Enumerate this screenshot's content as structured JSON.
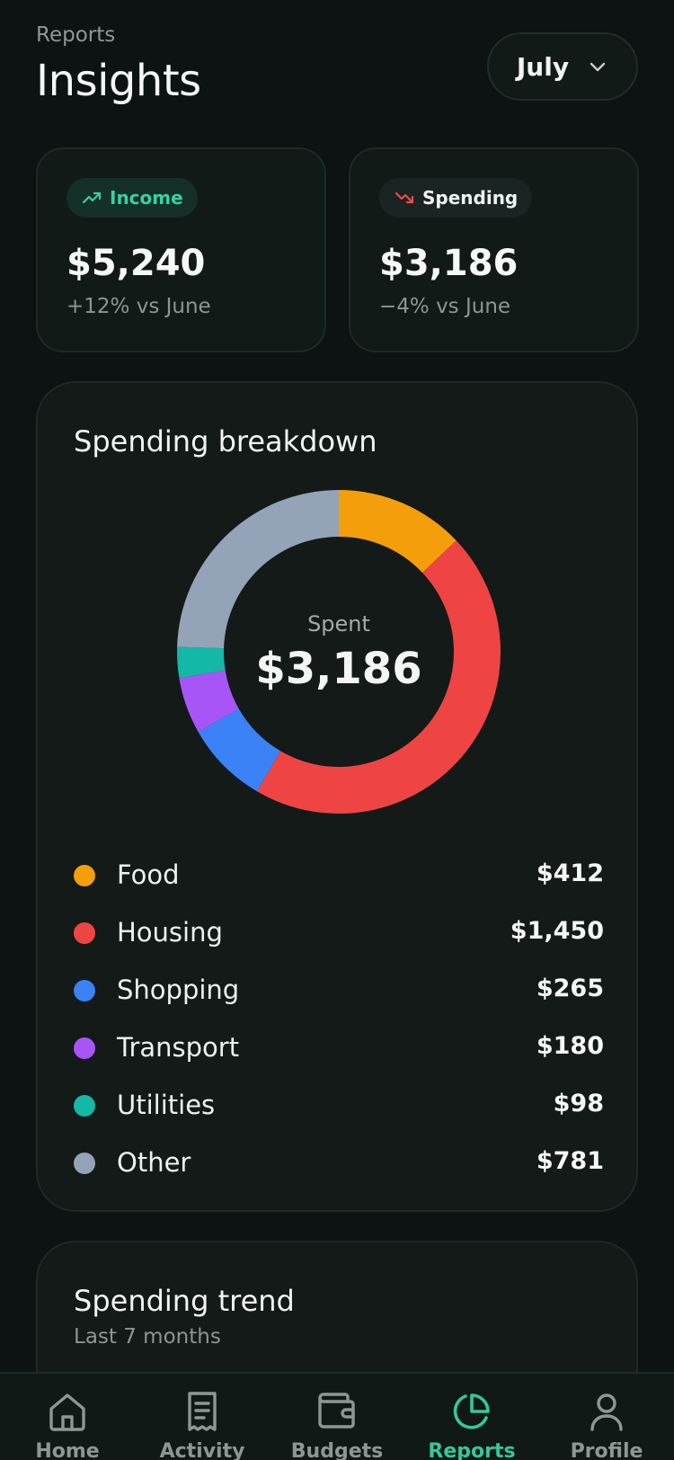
{
  "header": {
    "eyebrow": "Reports",
    "title": "Insights",
    "month": "July"
  },
  "stats": {
    "income": {
      "label": "Income",
      "value": "$5,240",
      "delta": "+12% vs June",
      "icon": "trending-up-icon",
      "color": "#3ad0a0"
    },
    "spending": {
      "label": "Spending",
      "value": "$3,186",
      "delta": "−4% vs June",
      "icon": "trending-down-icon",
      "color": "#ef4b4b"
    }
  },
  "breakdown": {
    "title": "Spending breakdown",
    "center_label": "Spent",
    "center_value": "$3,186",
    "items": [
      {
        "name": "Food",
        "amount": "$412",
        "value": 412,
        "color": "#f59e0b"
      },
      {
        "name": "Housing",
        "amount": "$1,450",
        "value": 1450,
        "color": "#ef4444"
      },
      {
        "name": "Shopping",
        "amount": "$265",
        "value": 265,
        "color": "#3b82f6"
      },
      {
        "name": "Transport",
        "amount": "$180",
        "value": 180,
        "color": "#a855f7"
      },
      {
        "name": "Utilities",
        "amount": "$98",
        "value": 98,
        "color": "#14b8a6"
      },
      {
        "name": "Other",
        "amount": "$781",
        "value": 781,
        "color": "#94a3b8"
      }
    ]
  },
  "chart_data": {
    "type": "pie",
    "title": "Spending breakdown",
    "categories": [
      "Food",
      "Housing",
      "Shopping",
      "Transport",
      "Utilities",
      "Other"
    ],
    "values": [
      412,
      1450,
      265,
      180,
      98,
      781
    ]
  },
  "trend": {
    "title": "Spending trend",
    "subtitle": "Last 7 months"
  },
  "tabs": [
    {
      "label": "Home",
      "icon": "home-icon",
      "active": false
    },
    {
      "label": "Activity",
      "icon": "receipt-icon",
      "active": false
    },
    {
      "label": "Budgets",
      "icon": "wallet-icon",
      "active": false
    },
    {
      "label": "Reports",
      "icon": "pie-chart-icon",
      "active": true
    },
    {
      "label": "Profile",
      "icon": "user-icon",
      "active": false
    }
  ]
}
